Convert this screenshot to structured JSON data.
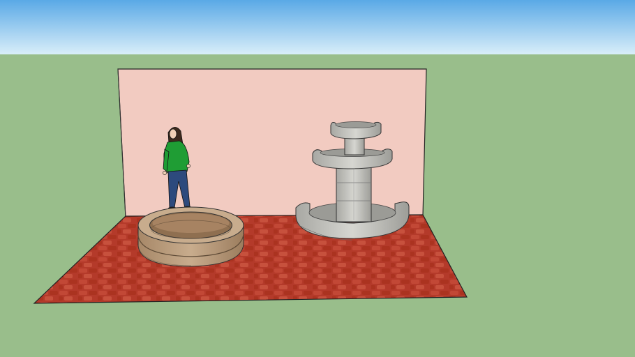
{
  "scene": {
    "sky_top_color": "#5aa9e6",
    "sky_bottom_color": "#d9eef9",
    "ground_color": "#99be8b",
    "wall_color": "#f2cbc1",
    "floor_color": "#b43a2a",
    "planter_color": "#b89a7b",
    "fountain_color": "#c5c5c0",
    "person": {
      "shirt_color": "#1f9d34",
      "pants_color": "#2d4a7d",
      "hair_color": "#3d2a1d"
    }
  }
}
